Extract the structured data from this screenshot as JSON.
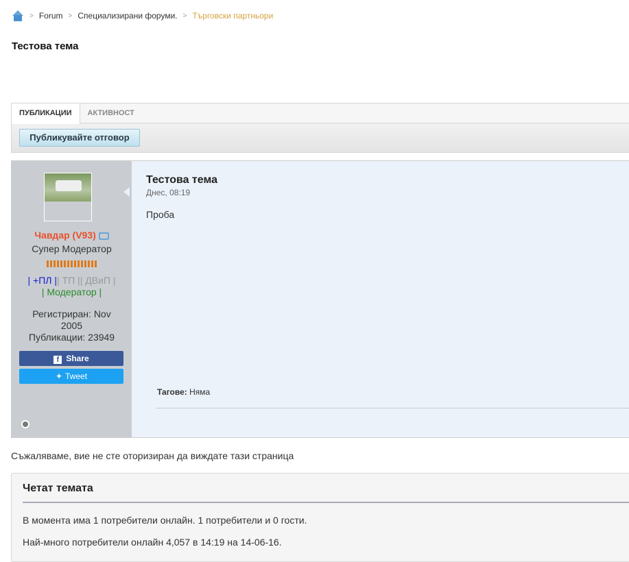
{
  "breadcrumb": {
    "items": [
      "Forum",
      "Специализирани форуми."
    ],
    "current": "Търговски партньори"
  },
  "page_title": "Тестова тема",
  "tabs": [
    {
      "label": "ПУБЛИКАЦИИ"
    },
    {
      "label": "АКТИВНОСТ"
    }
  ],
  "toolbar": {
    "reply_label": "Публикувайте отговор"
  },
  "post": {
    "author": {
      "name": "Чавдар (V93)",
      "role": "Супер Модератор",
      "groups_line1_a": "| +ПЛ |",
      "groups_line1_b": "| ТП || ДВиП |",
      "groups_line2": "| Модератор |",
      "joined": "Регистриран: Nov 2005",
      "posts": "Публикации: 23949"
    },
    "share_label": "Share",
    "tweet_label": "Tweet",
    "title": "Тестова тема",
    "date": "Днес, 08:19",
    "text": "Проба",
    "tags_label": "Тагове:",
    "tags_value": "Няма"
  },
  "denied_message": "Съжаляваме, вие не сте оторизиран да виждате тази страница",
  "readers": {
    "title": "Четат темата",
    "line1": "В момента има 1 потребители онлайн. 1 потребители и 0 гости.",
    "line2": "Най-много потребители онлайн 4,057 в 14:19 на 14-06-16."
  },
  "colors": {
    "username": "#e8502c",
    "link_current": "#d4a340",
    "facebook": "#3b5998",
    "twitter": "#1da1f2"
  }
}
